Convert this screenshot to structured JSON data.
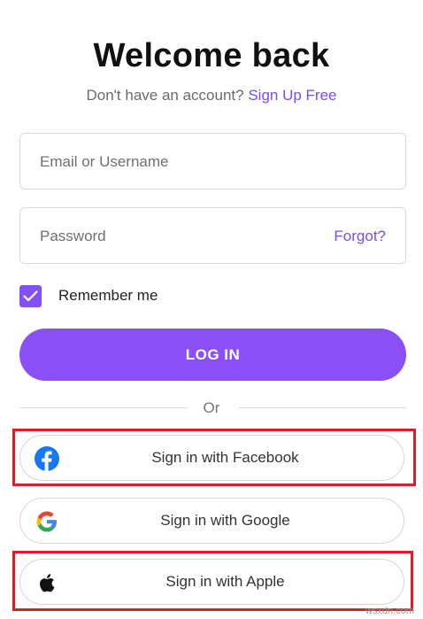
{
  "header": {
    "title": "Welcome back",
    "subtitle_prefix": "Don't have an account?",
    "signup_link": "Sign Up Free"
  },
  "form": {
    "email_placeholder": "Email or Username",
    "password_placeholder": "Password",
    "forgot_label": "Forgot?",
    "remember_label": "Remember me",
    "remember_checked": true,
    "login_label": "LOG IN"
  },
  "divider_label": "Or",
  "social": [
    {
      "label": "Sign in with Facebook",
      "icon": "facebook-icon",
      "highlighted": true
    },
    {
      "label": "Sign in with Google",
      "icon": "google-icon",
      "highlighted": false
    },
    {
      "label": "Sign in with Apple",
      "icon": "apple-icon",
      "highlighted": true
    }
  ],
  "watermark": "wsxdn.com",
  "colors": {
    "accent": "#8a4ff5",
    "link": "#7b4bf0",
    "highlight_border": "#d8202a",
    "facebook": "#1877f2"
  }
}
